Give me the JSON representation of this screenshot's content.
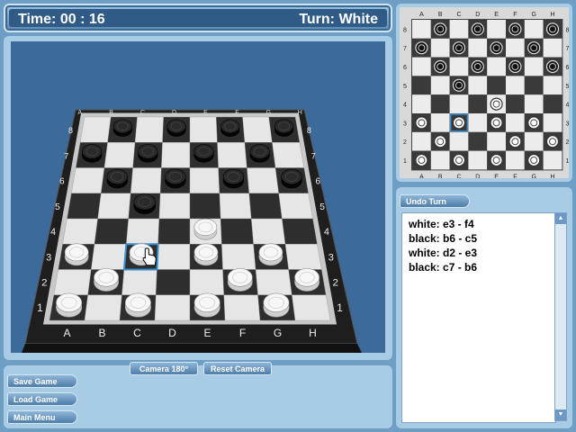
{
  "status": {
    "time": "Time: 00 : 16",
    "turn": "Turn: White"
  },
  "files": [
    "A",
    "B",
    "C",
    "D",
    "E",
    "F",
    "G",
    "H"
  ],
  "ranks": [
    "8",
    "7",
    "6",
    "5",
    "4",
    "3",
    "2",
    "1"
  ],
  "pieces": {
    "black": [
      "b8",
      "d8",
      "f8",
      "h8",
      "a7",
      "c7",
      "e7",
      "g7",
      "b6",
      "d6",
      "f6",
      "h6",
      "c5"
    ],
    "white": [
      "e4",
      "a3",
      "c3",
      "e3",
      "g3",
      "b2",
      "f2",
      "h2",
      "a1",
      "c1",
      "e1",
      "g1"
    ]
  },
  "selected_square": "c3",
  "camera_buttons": {
    "rotate": "Camera 180°",
    "reset": "Reset Camera"
  },
  "game_menu": {
    "save": "Save Game",
    "load": "Load Game",
    "main": "Main Menu"
  },
  "undo_label": "Undo Turn",
  "move_history": [
    "white: e3 - f4",
    "black: b6 - c5",
    "white: d2 - e3",
    "black: c7 - b6"
  ],
  "colors": {
    "dark_square": "#2e2e2e",
    "light_square": "#e6e6e6",
    "panel": "#a8cbe6",
    "scene": "#3c6a9b"
  }
}
